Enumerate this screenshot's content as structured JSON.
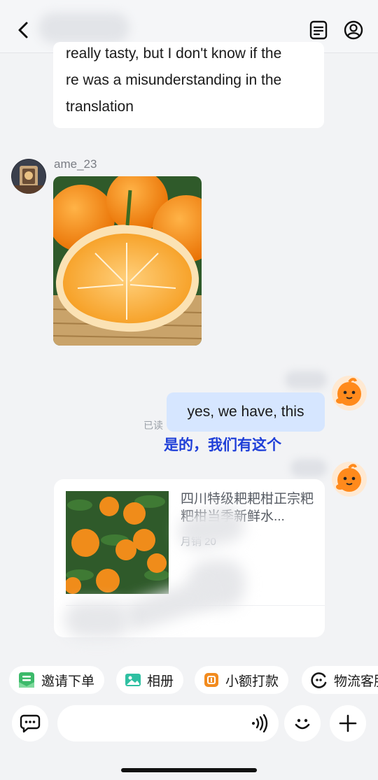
{
  "header": {
    "back_icon": "chevron-left-icon",
    "order_icon": "document-list-icon",
    "profile_icon": "user-circle-icon"
  },
  "messages": {
    "incoming_text": {
      "lines": [
        "really tasty, but I don't know if the",
        "re was a misunderstanding in the",
        "translation"
      ]
    },
    "incoming_image": {
      "sender": "ame_23",
      "image_alt": "peeled orange tangerine on a bamboo tray"
    },
    "outgoing_text": {
      "text": "yes, we have, this",
      "read_status": "已读",
      "translation": "是的，我们有这个"
    },
    "product_card": {
      "title": "四川特级耙耙柑正宗粑粑柑当季新鲜水...",
      "sales": "月销 20"
    }
  },
  "quick_actions": [
    {
      "label": "邀请下单",
      "icon": "invite-order-icon",
      "color": "#3cba6a"
    },
    {
      "label": "相册",
      "icon": "album-icon",
      "color": "#2fc0a2"
    },
    {
      "label": "小额打款",
      "icon": "payment-icon",
      "color": "#f28b1e"
    },
    {
      "label": "物流客服",
      "icon": "logistics-service-icon",
      "color": "#1a1a1a"
    }
  ],
  "input_bar": {
    "quick_reply_icon": "chat-bubble-icon",
    "voice_icon": "voice-wave-icon",
    "emoji_icon": "smiley-icon",
    "add_icon": "plus-icon"
  },
  "colors": {
    "outgoing_bubble": "#d6e6ff",
    "translation_text": "#1f3fd8",
    "background": "#f2f3f5"
  }
}
